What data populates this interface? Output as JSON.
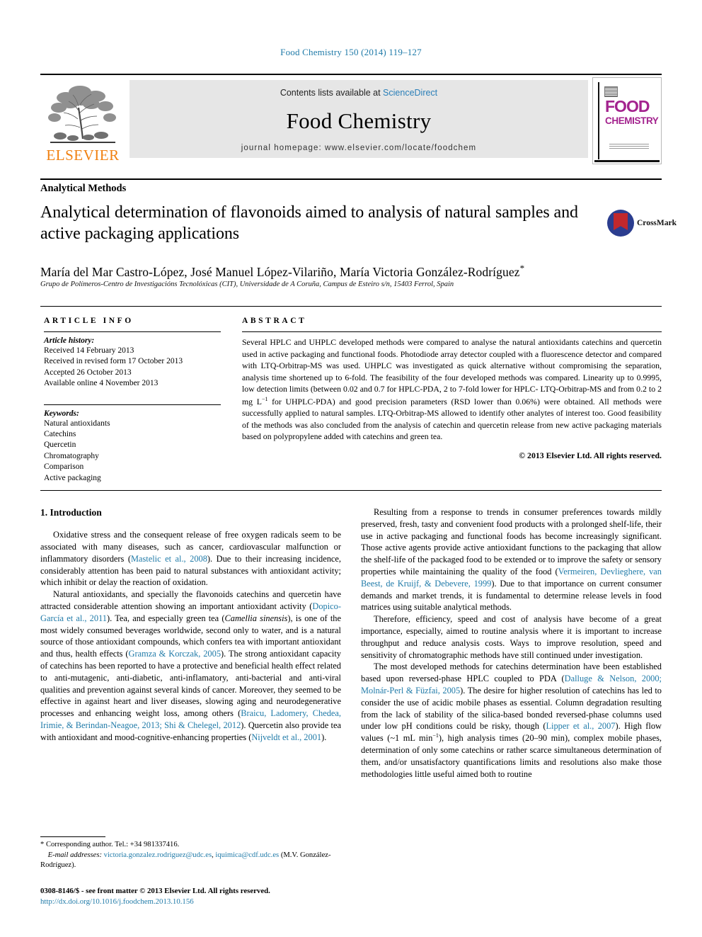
{
  "running_head": "Food Chemistry 150 (2014) 119–127",
  "masthead": {
    "publisher_logo_text": "ELSEVIER",
    "contents_prefix": "Contents lists available at ",
    "contents_link": "ScienceDirect",
    "journal_title": "Food Chemistry",
    "homepage": "journal homepage: www.elsevier.com/locate/foodchem",
    "cover": {
      "line1": "FOOD",
      "line2": "CHEMISTRY"
    }
  },
  "section_label": "Analytical Methods",
  "article": {
    "title": "Analytical determination of flavonoids aimed to analysis of natural samples and active packaging applications",
    "crossmark_label": "CrossMark",
    "authors": "María del Mar Castro-López, José Manuel López-Vilariño, María Victoria González-Rodríguez",
    "corresponding_marker": "*",
    "affiliation": "Grupo de Polímeros-Centro de Investigacións Tecnolóxicas (CIT), Universidade de A Coruña, Campus de Esteiro s/n, 15403 Ferrol, Spain"
  },
  "article_info": {
    "heading": "ARTICLE INFO",
    "history_label": "Article history:",
    "history": [
      "Received 14 February 2013",
      "Received in revised form 17 October 2013",
      "Accepted 26 October 2013",
      "Available online 4 November 2013"
    ],
    "keywords_label": "Keywords:",
    "keywords": [
      "Natural antioxidants",
      "Catechins",
      "Quercetin",
      "Chromatography",
      "Comparison",
      "Active packaging"
    ]
  },
  "abstract": {
    "heading": "ABSTRACT",
    "p1": "Several HPLC and UHPLC developed methods were compared to analyse the natural antioxidants catechins and quercetin used in active packaging and functional foods. Photodiode array detector coupled with a fluorescence detector and compared with LTQ-Orbitrap-MS was used. UHPLC was investigated as quick alternative without compromising the separation, analysis time shortened up to 6-fold. The feasibility of the four developed methods was compared. Linearity up to 0.9995, low detection limits (between 0.02 and 0.7 for HPLC-PDA, 2 to 7-fold lower for HPLC- LTQ-Orbitrap-MS and from 0.2 to 2 mg L",
    "p1_sup": "−1",
    "p1_cont": " for UHPLC-PDA) and good precision parameters (RSD lower than 0.06%) were obtained. All methods were successfully applied to natural samples. LTQ-Orbitrap-MS allowed to identify other analytes of interest too. Good feasibility of the methods was also concluded from the analysis of catechin and quercetin release from new active packaging materials based on polypropylene added with catechins and green tea.",
    "copyright": "© 2013 Elsevier Ltd. All rights reserved."
  },
  "body": {
    "intro_heading": "1. Introduction",
    "left": {
      "p1_a": "Oxidative stress and the consequent release of free oxygen radicals seem to be associated with many diseases, such as cancer, cardiovascular malfunction or inflammatory disorders (",
      "p1_ref": "Mastelic et al., 2008",
      "p1_b": "). Due to their increasing incidence, considerably attention has been paid to natural substances with antioxidant activity; which inhibit or delay the reaction of oxidation.",
      "p2_a": "Natural antioxidants, and specially the flavonoids catechins and quercetin have attracted considerable attention showing an important antioxidant activity (",
      "p2_ref1": "Dopico-García et al., 2011",
      "p2_b": "). Tea, and especially green tea (",
      "p2_italic": "Camellia sinensis",
      "p2_c": "), is one of the most widely consumed beverages worldwide, second only to water, and is a natural source of those antioxidant compounds, which confers tea with important antioxidant and thus, health effects (",
      "p2_ref2": "Gramza & Korczak, 2005",
      "p2_d": "). The strong antioxidant capacity of catechins has been reported to have a protective and beneficial health effect related to anti-mutagenic, anti-diabetic, anti-inflamatory, anti-bacterial and anti-viral qualities and prevention against several kinds of cancer. Moreover, they seemed to be effective in against heart and liver diseases, slowing aging and neurodegenerative processes and enhancing weight loss, among others (",
      "p2_ref3": "Braicu, Ladomery, Chedea, Irimie, & Berindan-Neagoe, 2013; Shi & Chelegel, 2012",
      "p2_e": "). Quercetin also provide tea with antioxidant and mood-cognitive-enhancing properties (",
      "p2_ref4": "Nijveldt et al., 2001",
      "p2_f": ")."
    },
    "right": {
      "p1_a": "Resulting from a response to trends in consumer preferences towards mildly preserved, fresh, tasty and convenient food products with a prolonged shelf-life, their use in active packaging and functional foods has become increasingly significant. Those active agents provide active antioxidant functions to the packaging that allow the shelf-life of the packaged food to be extended or to improve the safety or sensory properties while maintaining the quality of the food (",
      "p1_ref": "Vermeiren, Devlieghere, van Beest, de Kruijf, & Debevere, 1999",
      "p1_b": "). Due to that importance on current consumer demands and market trends, it is fundamental to determine release levels in food matrices using suitable analytical methods.",
      "p2": "Therefore, efficiency, speed and cost of analysis have become of a great importance, especially, aimed to routine analysis where it is important to increase throughput and reduce analysis costs. Ways to improve resolution, speed and sensitivity of chromatographic methods have still continued under investigation.",
      "p3_a": "The most developed methods for catechins determination have been established based upon reversed-phase HPLC coupled to PDA (",
      "p3_ref1": "Dalluge & Nelson, 2000; Molnár-Perl & Füzfai, 2005",
      "p3_b": "). The desire for higher resolution of catechins has led to consider the use of acidic mobile phases as essential. Column degradation resulting from the lack of stability of the silica-based bonded reversed-phase columns used under low pH conditions could be risky, though (",
      "p3_ref2": "Lipper et al., 2007",
      "p3_c": "). High flow values (~1 mL min",
      "p3_sup": "−1",
      "p3_d": "), high analysis times (20–90 min), complex mobile phases, determination of only some catechins or rather scarce simultaneous determination of them, and/or unsatisfactory quantifications limits and resolutions also make those methodologies little useful aimed both to routine"
    }
  },
  "footnotes": {
    "corresponding": "* Corresponding author. Tel.: +34 981337416.",
    "email_label": "E-mail addresses:",
    "email1": "victoria.gonzalez.rodriguez@udc.es",
    "email_sep": ", ",
    "email2": "iquimica@cdf.udc.es",
    "email_owner": "(M.V. González-Rodríguez).",
    "issn_line": "0308-8146/$ - see front matter © 2013 Elsevier Ltd. All rights reserved.",
    "doi": "http://dx.doi.org/10.1016/j.foodchem.2013.10.156"
  },
  "colors": {
    "link": "#1f7aa8",
    "elsevier_orange": "#f08010",
    "cover_magenta": "#a3238e",
    "sciencedirect": "#2a7fb8"
  }
}
